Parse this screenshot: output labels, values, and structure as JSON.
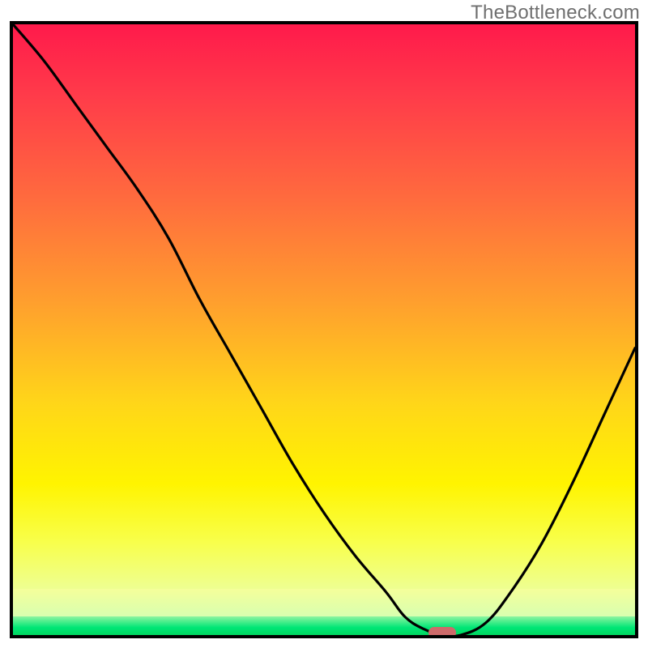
{
  "watermark": "TheBottleneck.com",
  "chart_data": {
    "type": "line",
    "title": "",
    "xlabel": "",
    "ylabel": "",
    "xlim": [
      0,
      100
    ],
    "ylim": [
      0,
      100
    ],
    "grid": false,
    "legend": false,
    "background": {
      "style": "vertical-gradient",
      "stops": [
        {
          "pos": 0.0,
          "color": "#ff1a4b"
        },
        {
          "pos": 0.3,
          "color": "#ff6a3e"
        },
        {
          "pos": 0.66,
          "color": "#ffd619"
        },
        {
          "pos": 0.9,
          "color": "#ecffa0"
        },
        {
          "pos": 0.97,
          "color": "#8cf5a0"
        },
        {
          "pos": 1.0,
          "color": "#00d760"
        }
      ]
    },
    "series": [
      {
        "name": "bottleneck-curve",
        "color": "#000000",
        "x": [
          0,
          5,
          10,
          15,
          20,
          25,
          30,
          35,
          40,
          45,
          50,
          55,
          60,
          63,
          66,
          69,
          72,
          76,
          80,
          85,
          90,
          95,
          100
        ],
        "y": [
          100,
          94,
          87,
          80,
          73,
          65,
          55,
          46,
          37,
          28,
          20,
          13,
          7,
          3,
          1,
          0,
          0,
          2,
          7,
          15,
          25,
          36,
          47
        ]
      }
    ],
    "marker": {
      "name": "optimal-point",
      "x": 69,
      "y": 0,
      "color": "#cd6a6a",
      "shape": "pill"
    }
  }
}
